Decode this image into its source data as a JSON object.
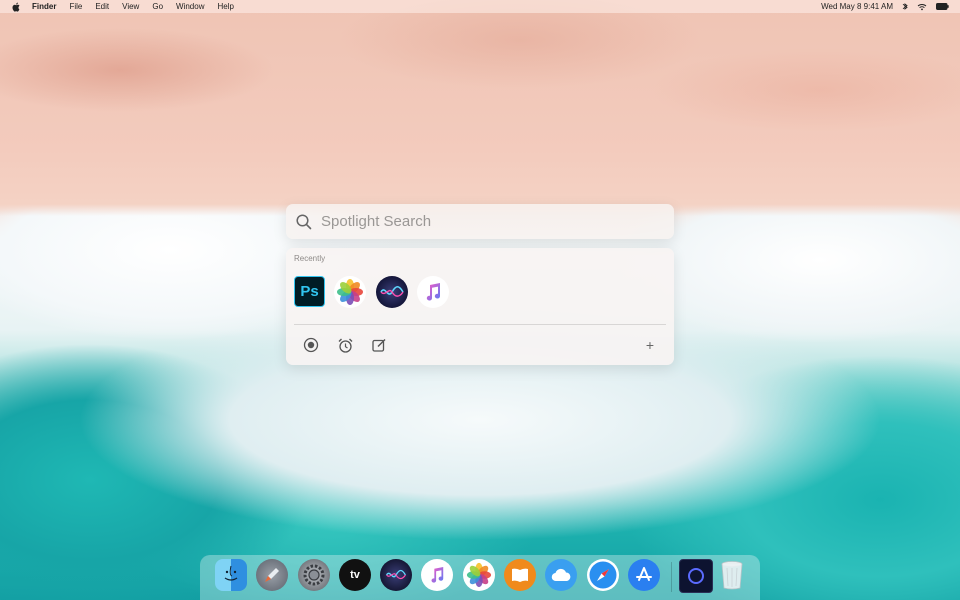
{
  "menubar": {
    "apple": "",
    "app_name": "Finder",
    "items": [
      "File",
      "Edit",
      "View",
      "Go",
      "Window",
      "Help"
    ],
    "datetime": "Wed May 8  9:41 AM"
  },
  "spotlight": {
    "placeholder": "Spotlight Search",
    "recent_label": "Recently",
    "recent_apps": [
      "photoshop-icon",
      "photos-icon",
      "siri-icon",
      "music-icon"
    ],
    "photoshop_text": "Ps",
    "shortcuts": [
      "record-icon",
      "alarm-clock-icon",
      "note-icon"
    ],
    "add_label": "+"
  },
  "dock": {
    "items": [
      "finder",
      "launchpad",
      "system-preferences",
      "apple-tv",
      "siri",
      "music",
      "photos",
      "books",
      "icloud",
      "safari",
      "app-store",
      "dark-app",
      "trash"
    ],
    "tv_label": "tv"
  }
}
